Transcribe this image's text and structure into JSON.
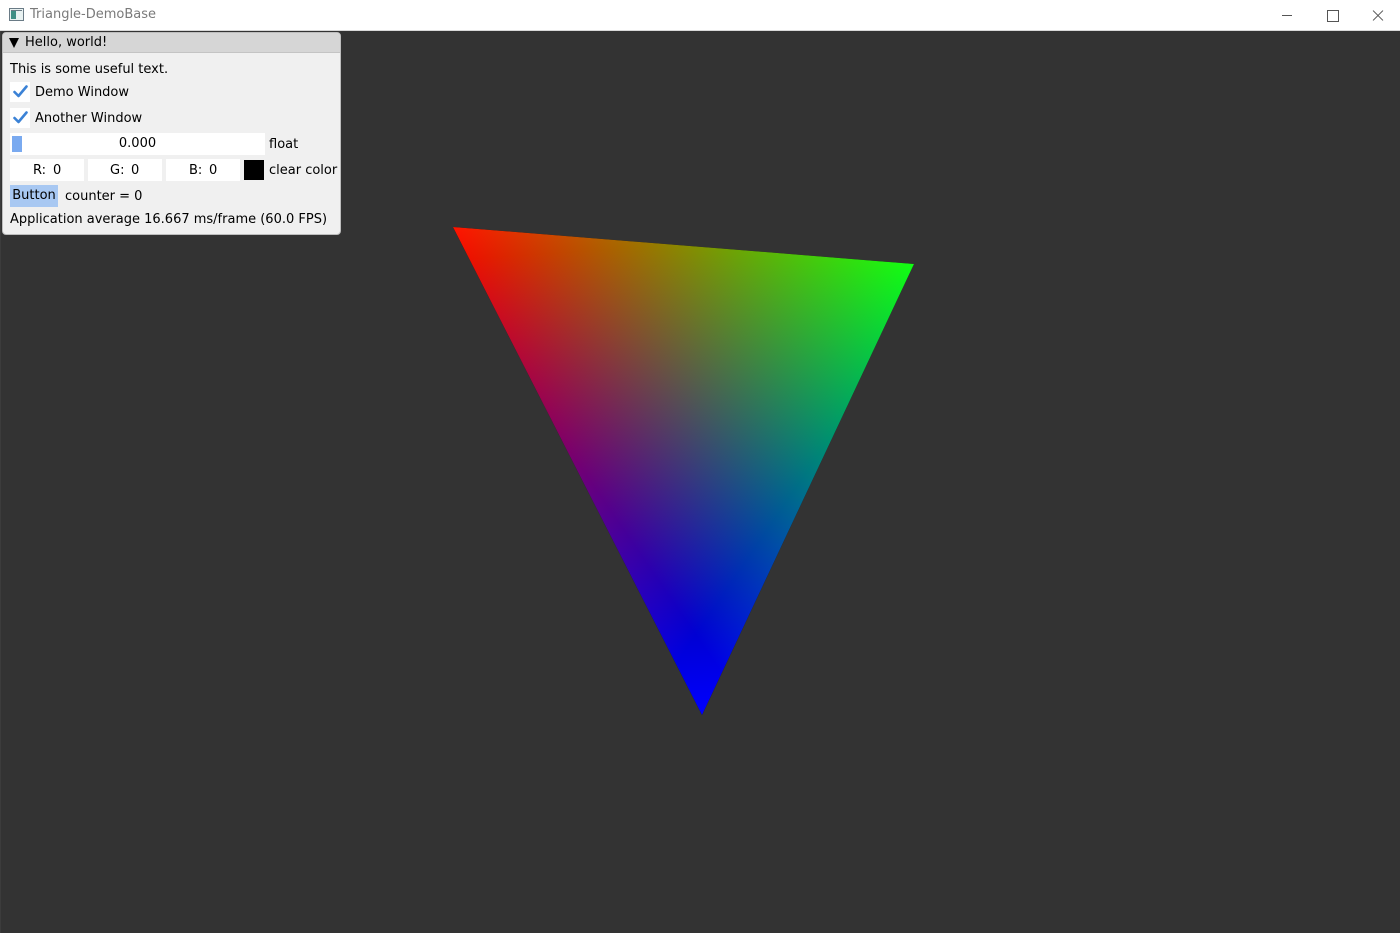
{
  "window": {
    "title": "Triangle-DemoBase"
  },
  "imgui": {
    "title": "Hello, world!",
    "text": "This is some useful text.",
    "checkboxes": [
      {
        "label": "Demo Window",
        "checked": true
      },
      {
        "label": "Another Window",
        "checked": true
      }
    ],
    "slider": {
      "value": "0.000",
      "label": "float",
      "fraction": 0.0
    },
    "color": {
      "r_label": "R:",
      "r": "0",
      "g_label": "G:",
      "g": "0",
      "b_label": "B:",
      "b": "0",
      "label": "clear color",
      "swatch": "#000000"
    },
    "button": {
      "label": "Button"
    },
    "counter": "counter = 0",
    "stats": "Application average 16.667 ms/frame (60.0 FPS)"
  },
  "scene": {
    "background": "#333333",
    "vertex_colors": [
      "#ff0000",
      "#00ff00",
      "#0000ff"
    ]
  }
}
